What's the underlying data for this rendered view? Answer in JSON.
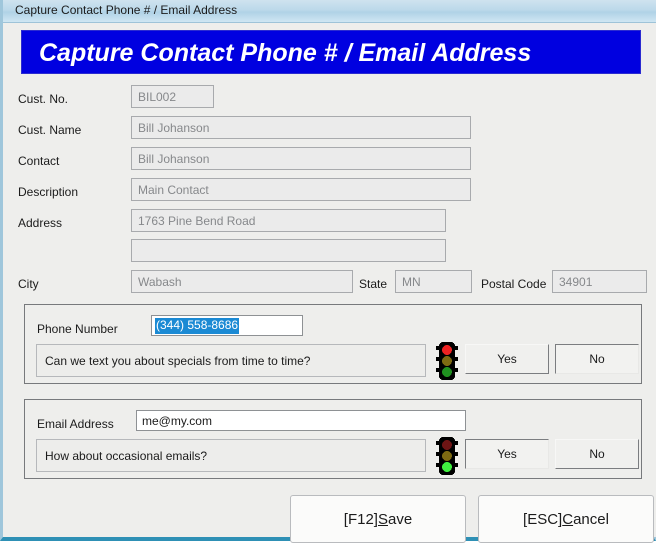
{
  "window": {
    "titlebar_text": "Capture Contact Phone # / Email Address",
    "banner_text": "Capture Contact Phone # / Email Address",
    "banner_color": "#0000e0",
    "banner_text_color": "#ffffff",
    "background_color": "#eeeeec",
    "frame_color": "#9fc6db",
    "frame_bottom_color": "#2e90b5"
  },
  "customer_fields": [
    {
      "label": "Cust. No.",
      "value": "BIL002",
      "readonly": true
    },
    {
      "label": "Cust. Name",
      "value": "Bill Johanson",
      "readonly": true
    },
    {
      "label": "Contact",
      "value": "Bill Johanson",
      "readonly": true
    },
    {
      "label": "Description",
      "value": "Main Contact",
      "readonly": true
    },
    {
      "label": "Address",
      "value": "1763 Pine Bend Road",
      "readonly": true
    },
    {
      "label": "",
      "value": "",
      "readonly": true
    },
    {
      "label": "City",
      "value": "Wabash",
      "readonly": true
    }
  ],
  "state_field": {
    "label": "State",
    "value": "MN",
    "readonly": true
  },
  "postal_field": {
    "label": "Postal Code",
    "value": "34901",
    "readonly": true
  },
  "phone_section": {
    "field_label": "Phone Number",
    "field_value": "(344) 558-8686",
    "field_selected": true,
    "selection_color": "#1b8ad4",
    "question": "Can we text you about specials from time to time?",
    "yes_label": "Yes",
    "no_label": "No",
    "selected_answer": "No",
    "signal": {
      "icon": "traffic-light-icon",
      "active_lamp": "red",
      "red_color": "#ee2222",
      "yellow_color": "#7d6a12",
      "green_color": "#1f8f1f"
    }
  },
  "email_section": {
    "field_label": "Email Address",
    "field_value": "me@my.com",
    "field_selected": false,
    "question": "How about occasional emails?",
    "yes_label": "Yes",
    "no_label": "No",
    "selected_answer": "Yes",
    "signal": {
      "icon": "traffic-light-icon",
      "active_lamp": "green",
      "red_color": "#6e1414",
      "yellow_color": "#7d6a12",
      "green_color": "#3ff03f"
    }
  },
  "footer": {
    "save": {
      "prefix": "[F12] ",
      "before": "",
      "accel": "S",
      "after": "ave"
    },
    "cancel": {
      "prefix": "[ESC] ",
      "before": "",
      "accel": "C",
      "after": "ancel"
    }
  }
}
